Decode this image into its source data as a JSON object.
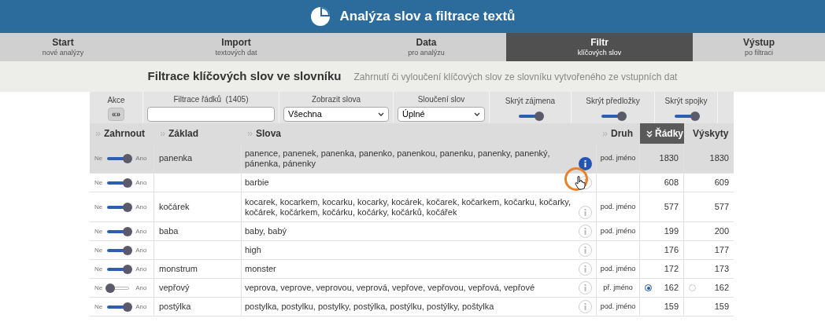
{
  "header": {
    "title": "Analýza slov a filtrace textů"
  },
  "nav": [
    {
      "title": "Start",
      "subtitle": "nové analýzy",
      "selected": false
    },
    {
      "title": "Import",
      "subtitle": "textových dat",
      "selected": false
    },
    {
      "title": "Data",
      "subtitle": "pro analýzu",
      "selected": false
    },
    {
      "title": "Filtr",
      "subtitle": "klíčových slov",
      "selected": true
    },
    {
      "title": "Výstup",
      "subtitle": "po filtraci",
      "selected": false
    }
  ],
  "section": {
    "title": "Filtrace klíčových slov ve slovníku",
    "description": "Zahrnutí či vyloučení klíčových slov ze slovníku vytvořeného ze vstupních dat"
  },
  "filters": {
    "action": {
      "label": "Akce",
      "button": "«»"
    },
    "row_filter": {
      "label": "Filtrace řádků  (1405)"
    },
    "selects": [
      {
        "label": "Zobrazit slova",
        "value": "Všechna"
      },
      {
        "label": "Sloučení slov",
        "value": "Úplné"
      }
    ],
    "toggles": [
      {
        "label": "Skrýt zájmena",
        "on": true
      },
      {
        "label": "Skrýt předložky",
        "on": true
      },
      {
        "label": "Skrýt spojky",
        "on": true
      }
    ]
  },
  "columns": [
    {
      "label": "Zahrnout",
      "sorted": false
    },
    {
      "label": "Základ",
      "sorted": false
    },
    {
      "label": "Slova",
      "sorted": false
    },
    {
      "label": "Druh",
      "sorted": false
    },
    {
      "label": "Řádky",
      "sorted": true
    },
    {
      "label": "Výskyty",
      "sorted": false
    }
  ],
  "rows": [
    {
      "label_off": "Ne",
      "label_on": "Ano",
      "included": true,
      "base": "panenka",
      "words": "panence, panenek, panenka, panenko, panenkou, panenku, panenky, panenký, pánenka, pánenky",
      "kind": "pod. jméno",
      "rows": "1830",
      "occurrences": "1830",
      "selected": true,
      "info_active": true
    },
    {
      "label_off": "Ne",
      "label_on": "Ano",
      "included": true,
      "base": "",
      "words": "barbie",
      "kind": "",
      "rows": "608",
      "occurrences": "609",
      "selected": false,
      "info_active": false
    },
    {
      "label_off": "Ne",
      "label_on": "Ano",
      "included": true,
      "base": "kočárek",
      "words": "kocarek, kocarkem, kocarku, kocarky, kocárek, kočarek, kočarkem, kočarku, kočarky, kočárek, kočárkem, kočárku, kočárky, kočárků, kočářek",
      "kind": "pod. jméno",
      "rows": "577",
      "occurrences": "577",
      "selected": false,
      "info_active": false
    },
    {
      "label_off": "Ne",
      "label_on": "Ano",
      "included": true,
      "base": "baba",
      "words": "baby, babý",
      "kind": "pod. jméno",
      "rows": "199",
      "occurrences": "200",
      "selected": false,
      "info_active": false
    },
    {
      "label_off": "Ne",
      "label_on": "Ano",
      "included": true,
      "base": "",
      "words": "high",
      "kind": "",
      "rows": "176",
      "occurrences": "177",
      "selected": false,
      "info_active": false
    },
    {
      "label_off": "Ne",
      "label_on": "Ano",
      "included": true,
      "base": "monstrum",
      "words": "monster",
      "kind": "pod. jméno",
      "rows": "172",
      "occurrences": "173",
      "selected": false,
      "info_active": false
    },
    {
      "label_off": "Ne",
      "label_on": "Ano",
      "included": false,
      "base": "vepřový",
      "words": "veprova, veprove, veprovou, veprová, vepřove, vepřovou, vepřová, vepřové",
      "kind": "př. jméno",
      "rows": "162",
      "occurrences": "162",
      "selected": false,
      "info_active": false,
      "radios": [
        {
          "selected": true
        },
        {
          "selected": false
        }
      ]
    },
    {
      "label_off": "Ne",
      "label_on": "Ano",
      "included": true,
      "base": "postýlka",
      "words": "postylka, postylku, postylky, postýlka, postýlku, postýlky, poštylka",
      "kind": "pod. jméno",
      "rows": "159",
      "occurrences": "159",
      "selected": false,
      "info_active": false
    }
  ]
}
